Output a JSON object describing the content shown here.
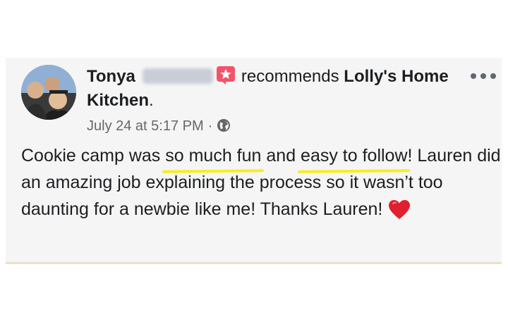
{
  "post": {
    "author_name": "Tonya",
    "action_text": "recommends",
    "page_name": "Lolly's Home Kitchen",
    "period": ".",
    "timestamp": "July 24 at 5:17 PM",
    "separator": "·",
    "icons": {
      "recommend": "star-badge-icon",
      "privacy": "globe-icon",
      "menu": "more-options-icon",
      "reaction": "heart-icon"
    },
    "body": {
      "part1": "Cookie camp was ",
      "highlight1": "so much fun",
      "part2": " and ",
      "highlight2": "easy to follow",
      "part3": "! Lauren did an amazing job explaining the process so it wasn’t too daunting for a newbie like me! Thanks Lauren!"
    }
  },
  "colors": {
    "background": "#f5f5f5",
    "text": "#1c1e21",
    "meta": "#65676b",
    "badge": "#f35369",
    "highlight": "#f6ef1e",
    "heart": "#e0202e"
  }
}
